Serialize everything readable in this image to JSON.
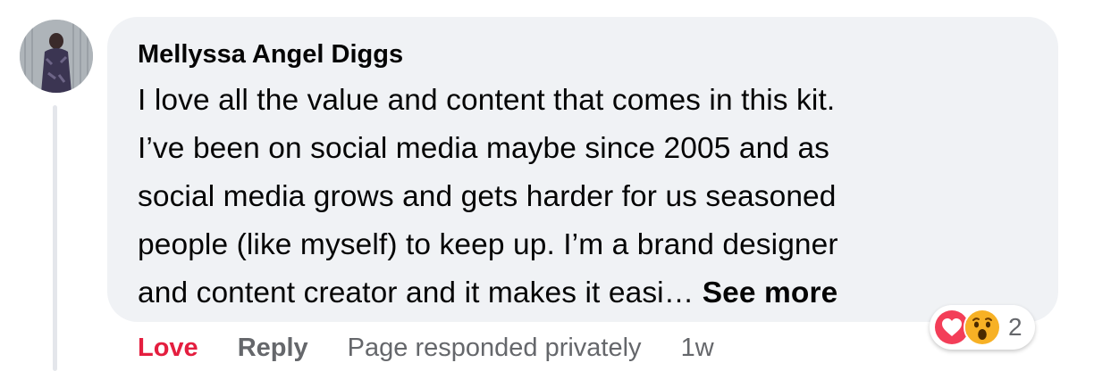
{
  "comment": {
    "author": "Mellyssa Angel Diggs",
    "text_lines": [
      "I love all the value and content that comes in this kit.",
      "I’ve been on social media maybe since 2005 and as",
      "social media grows and gets harder for us seasoned",
      "people (like myself) to keep up. I’m a brand designer",
      "and content creator and it makes it easi… "
    ],
    "see_more_label": "See more"
  },
  "actions": {
    "love_label": "Love",
    "reply_label": "Reply",
    "page_responded": "Page responded privately",
    "timestamp": "1w"
  },
  "reactions": {
    "icons": [
      "love-heart-icon",
      "wow-face-icon"
    ],
    "count": "2"
  },
  "colors": {
    "bubble_bg": "#f0f2f5",
    "love_red": "#e41e3f",
    "meta_gray": "#65676b",
    "heart_pink": "#f33e58",
    "wow_yellow": "#f7b125"
  }
}
